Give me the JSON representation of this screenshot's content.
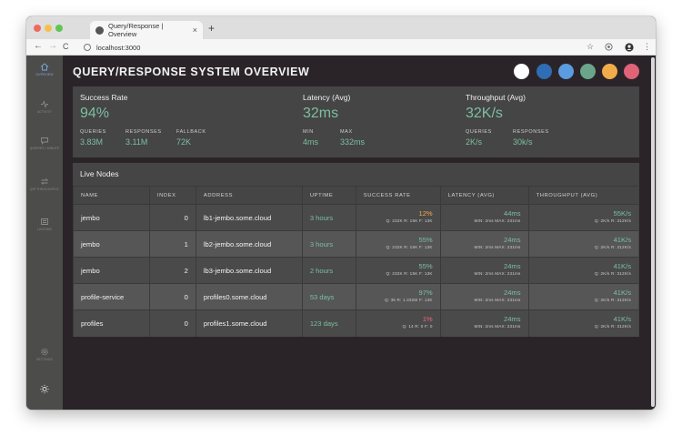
{
  "browser": {
    "tab_title": "Query/Response | Overview",
    "tab_close": "×",
    "new_tab": "+",
    "url": "localhost:3000",
    "back": "←",
    "forward": "→",
    "reload": "C",
    "star": "☆",
    "menu": "⋮"
  },
  "sidebar": {
    "items": [
      {
        "label": "OVERVIEW",
        "icon": "home-icon",
        "active": true
      },
      {
        "label": "ACTIVITY",
        "icon": "activity-icon",
        "active": false
      },
      {
        "label": "QUERIES / MINUTE",
        "icon": "chat-icon",
        "active": false
      },
      {
        "label": "Q/R THROUGHPUT",
        "icon": "swap-icon",
        "active": false
      },
      {
        "label": "LOGGING",
        "icon": "list-icon",
        "active": false
      },
      {
        "label": "SETTINGS",
        "icon": "gear-icon",
        "active": false
      },
      {
        "label": "",
        "icon": "sun-icon",
        "active": false
      }
    ]
  },
  "header": {
    "title": "QUERY/RESPONSE SYSTEM OVERVIEW",
    "swatches": [
      "#ffffff",
      "#2f6db5",
      "#5b9be0",
      "#6aa58b",
      "#f0ac4a",
      "#e06378"
    ]
  },
  "summary": {
    "success": {
      "label": "Success Rate",
      "value": "94%",
      "subs": [
        {
          "label": "QUERIES",
          "value": "3.83M"
        },
        {
          "label": "RESPONSES",
          "value": "3.11M"
        },
        {
          "label": "FALLBACK",
          "value": "72K"
        }
      ]
    },
    "latency": {
      "label": "Latency (Avg)",
      "value": "32ms",
      "subs": [
        {
          "label": "MIN",
          "value": "4ms"
        },
        {
          "label": "MAX",
          "value": "332ms"
        }
      ]
    },
    "throughput": {
      "label": "Throughput (Avg)",
      "value": "32K/s",
      "subs": [
        {
          "label": "QUERIES",
          "value": "2K/s"
        },
        {
          "label": "RESPONSES",
          "value": "30k/s"
        }
      ]
    }
  },
  "nodes": {
    "title": "Live Nodes",
    "columns": [
      "NAME",
      "INDEX",
      "ADDRESS",
      "UPTIME",
      "SUCCESS RATE",
      "LATENCY (AVG)",
      "THROUGHPUT (AVG)"
    ],
    "rows": [
      {
        "name": "jembo",
        "index": "0",
        "address": "lb1-jembo.some.cloud",
        "uptime": "3 hours",
        "success": "12%",
        "success_status": "orange",
        "success_detail": "Q: 232K   R: 15K   F: 13K",
        "latency": "44ms",
        "latency_detail": "MIN: 2ms   MAX: 231ms",
        "throughput": "55K/s",
        "throughput_detail": "Q: 2K/s   R: 312K/s"
      },
      {
        "name": "jembo",
        "index": "1",
        "address": "lb2-jembo.some.cloud",
        "uptime": "3 hours",
        "success": "55%",
        "success_status": "green",
        "success_detail": "Q: 232K   R: 15K   F: 13K",
        "latency": "24ms",
        "latency_detail": "MIN: 2ms   MAX: 231ms",
        "throughput": "41K/s",
        "throughput_detail": "Q: 2K/s   R: 312K/s"
      },
      {
        "name": "jembo",
        "index": "2",
        "address": "lb3-jembo.some.cloud",
        "uptime": "2 hours",
        "success": "55%",
        "success_status": "green",
        "success_detail": "Q: 232K   R: 15K   F: 13K",
        "latency": "24ms",
        "latency_detail": "MIN: 2ms   MAX: 231ms",
        "throughput": "41K/s",
        "throughput_detail": "Q: 2K/s   R: 312K/s"
      },
      {
        "name": "profile-service",
        "index": "0",
        "address": "profiles0.some.cloud",
        "uptime": "53 days",
        "success": "97%",
        "success_status": "green",
        "success_detail": "Q: 3k   R: 1.332M   F: 13K",
        "latency": "24ms",
        "latency_detail": "MIN: 2ms   MAX: 231ms",
        "throughput": "41K/s",
        "throughput_detail": "Q: 2K/s   R: 312K/s"
      },
      {
        "name": "profiles",
        "index": "0",
        "address": "profiles1.some.cloud",
        "uptime": "123 days",
        "success": "1%",
        "success_status": "red",
        "success_detail": "Q: 14   R: 0   F: 0",
        "latency": "24ms",
        "latency_detail": "MIN: 2ms   MAX: 231ms",
        "throughput": "41K/s",
        "throughput_detail": "Q: 2K/s   R: 312K/s"
      }
    ]
  }
}
